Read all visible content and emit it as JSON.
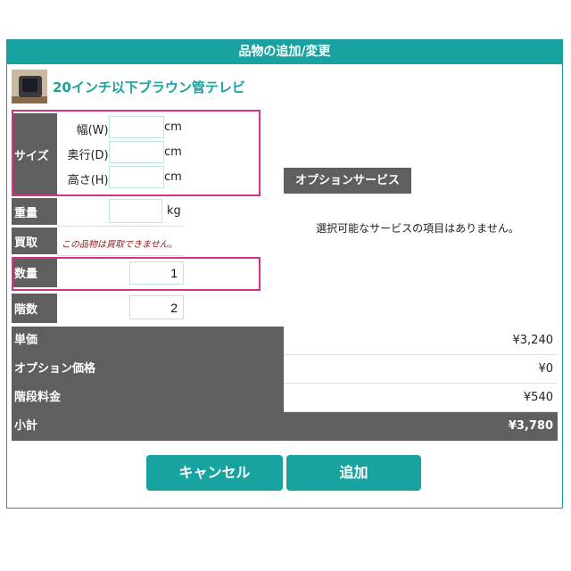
{
  "dialog": {
    "title": "品物の追加/変更"
  },
  "product": {
    "name": "20インチ以下ブラウン管テレビ",
    "thumbnail_icon": "crt-tv-thumbnail"
  },
  "size": {
    "label": "サイズ",
    "width_label": "幅(W):",
    "depth_label": "奥行(D):",
    "height_label": "高さ(H):",
    "unit": "cm",
    "width_value": "",
    "depth_value": "",
    "height_value": ""
  },
  "weight": {
    "label": "重量",
    "value": "",
    "unit": "kg"
  },
  "purchase": {
    "label": "買取",
    "note": "この品物は買取できません。"
  },
  "quantity": {
    "label": "数量",
    "value": "1"
  },
  "floors": {
    "label": "階数",
    "value": "2"
  },
  "options": {
    "header": "オプションサービス",
    "message": "選択可能なサービスの項目はありません。"
  },
  "summary": {
    "unit_price_label": "単価",
    "unit_price": "¥3,240",
    "option_price_label": "オプション価格",
    "option_price": "¥0",
    "stair_fee_label": "階段料金",
    "stair_fee": "¥540",
    "subtotal_label": "小計",
    "subtotal": "¥3,780"
  },
  "buttons": {
    "cancel": "キャンセル",
    "add": "追加"
  },
  "colors": {
    "accent": "#18a3a0",
    "label_bg": "#5f5f5f",
    "highlight": "#d6328a",
    "note": "#8b1a1a"
  }
}
